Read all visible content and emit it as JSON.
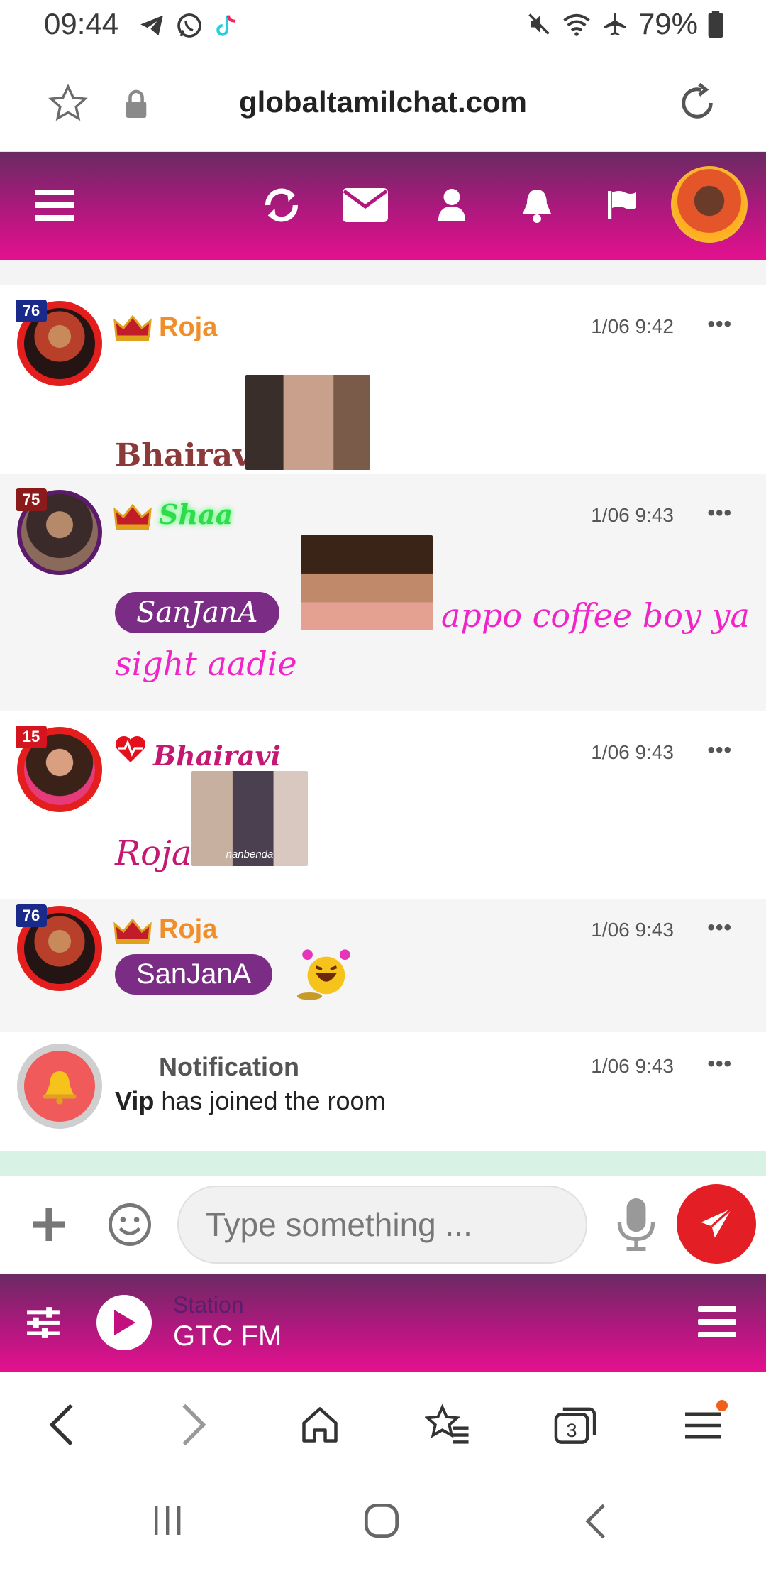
{
  "status_bar": {
    "time": "09:44",
    "battery": "79%"
  },
  "browser": {
    "url": "globaltamilchat.com",
    "tab_count": "3"
  },
  "messages": [
    {
      "username": "Roja",
      "time": "1/06 9:42",
      "rank": "76",
      "rank_color": "#1a2a8a",
      "name_color": "#ef8f2b",
      "text": "Bhairavi",
      "text_color": "#8b3a3a"
    },
    {
      "username": "Shaa",
      "time": "1/06 9:43",
      "rank": "75",
      "rank_color": "#8b1a1a",
      "name_color": "#2edb4a",
      "mention": "SanJanA",
      "text_after": "appo coffee boy ya",
      "text_line2": "sight aadie",
      "text_color": "#f024c8"
    },
    {
      "username": "Bhairavi",
      "time": "1/06 9:43",
      "rank": "15",
      "rank_color": "#d4151f",
      "name_color": "#c41872",
      "text": "Roja",
      "text_color": "#c41872",
      "gif_caption": "nanbenda"
    },
    {
      "username": "Roja",
      "time": "1/06 9:43",
      "rank": "76",
      "rank_color": "#1a2a8a",
      "name_color": "#ef8f2b",
      "mention": "SanJanA"
    }
  ],
  "notification": {
    "title": "Notification",
    "time": "1/06 9:43",
    "user": "Vip",
    "text": "has joined the room"
  },
  "composer": {
    "placeholder": "Type something ..."
  },
  "player": {
    "station_label": "Station",
    "station_name": "GTC FM"
  },
  "more_label": "•••"
}
